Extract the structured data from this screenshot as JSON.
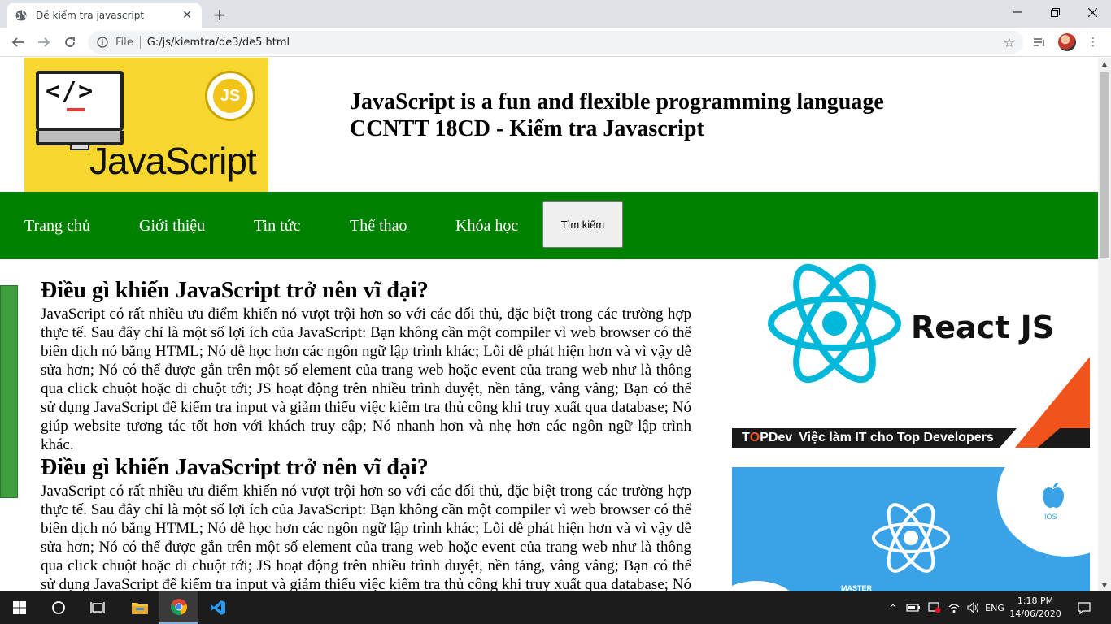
{
  "browser": {
    "tab_title": "Đề kiểm tra javascript",
    "scheme_label": "File",
    "url": "G:/js/kiemtra/de3/de5.html"
  },
  "header": {
    "logo_word": "JavaScript",
    "logo_code": "</>",
    "logo_badge": "JS",
    "title_line1": "JavaScript is a fun and flexible programming language",
    "title_line2": "CCNTT 18CD - Kiểm tra Javascript"
  },
  "menu": {
    "items": [
      "Trang chủ",
      "Giới thiệu",
      "Tin tức",
      "Thể thao",
      "Khóa học"
    ],
    "search_label": "Tìm kiếm"
  },
  "articles": [
    {
      "heading": "Điều gì khiến JavaScript trở nên vĩ đại?",
      "body": "JavaScript có rất nhiều ưu điểm khiến nó vượt trội hơn so với các đối thủ, đặc biệt trong các trường hợp thực tế. Sau đây chỉ là một số lợi ích của JavaScript: Bạn không cần một compiler vì web browser có thể biên dịch nó bằng HTML; Nó dễ học hơn các ngôn ngữ lập trình khác; Lỗi dễ phát hiện hơn và vì vậy dễ sửa hơn; Nó có thể được gắn trên một số element của trang web hoặc event của trang web như là thông qua click chuột hoặc di chuột tới; JS hoạt động trên nhiều trình duyệt, nền tảng, vâng vâng; Bạn có thể sử dụng JavaScript để kiểm tra input và giảm thiểu việc kiểm tra thủ công khi truy xuất qua database; Nó giúp website tương tác tốt hơn với khách truy cập; Nó nhanh hơn và nhẹ hơn các ngôn ngữ lập trình khác."
    },
    {
      "heading": "Điều gì khiến JavaScript trở nên vĩ đại?",
      "body": "JavaScript có rất nhiều ưu điểm khiến nó vượt trội hơn so với các đối thủ, đặc biệt trong các trường hợp thực tế. Sau đây chỉ là một số lợi ích của JavaScript: Bạn không cần một compiler vì web browser có thể biên dịch nó bằng HTML; Nó dễ học hơn các ngôn ngữ lập trình khác; Lỗi dễ phát hiện hơn và vì vậy dễ sửa hơn; Nó có thể được gắn trên một số element của trang web hoặc event của trang web như là thông qua click chuột hoặc di chuột tới; JS hoạt động trên nhiều trình duyệt, nền tảng, vâng vâng; Bạn có thể sử dụng JavaScript để kiểm tra input và giảm thiểu việc kiểm tra thủ công khi truy xuất qua database; Nó giúp website tương tác tốt hơn với khách truy cập; Nó nhanh hơn và nhẹ hơn các ngôn ngữ lập trình khác."
    }
  ],
  "aside": {
    "ad1_title": "React JS",
    "ad1_brand_prefix": "T",
    "ad1_brand_accent": "O",
    "ad1_brand_suffix": "PDev",
    "ad1_slogan": "Việc làm IT cho Top Developers",
    "ad2_platform": "IOS",
    "ad2_caption": "MASTER"
  },
  "taskbar": {
    "language": "ENG",
    "time": "1:18 PM",
    "date": "14/06/2020"
  },
  "colors": {
    "menu_bg": "#008000",
    "logo_bg": "#f7d630",
    "react_blue": "#00b8d9",
    "accent_orange": "#f0531c",
    "ios_blue": "#3aa3e8"
  }
}
